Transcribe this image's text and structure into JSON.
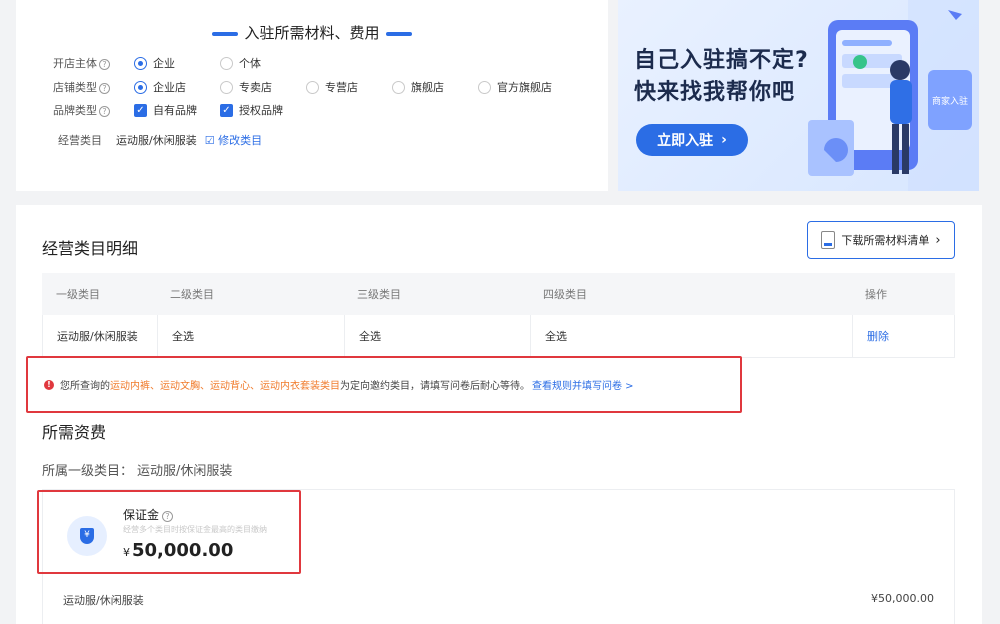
{
  "form": {
    "title": "入驻所需材料、费用",
    "rows": [
      {
        "label": "开店主体",
        "options": [
          "企业",
          "个体"
        ],
        "selected": 0
      },
      {
        "label": "店铺类型",
        "options": [
          "企业店",
          "专卖店",
          "专营店",
          "旗舰店",
          "官方旗舰店"
        ],
        "selected": 0
      },
      {
        "label": "品牌类型",
        "options": [
          "自有品牌",
          "授权品牌"
        ],
        "checked": [
          0,
          1
        ]
      }
    ],
    "category_label": "经营类目",
    "category_value": "运动服/休闲服装",
    "edit_link": "修改类目",
    "help_icon": "question-circle-icon"
  },
  "banner": {
    "line1": "自己入驻搞不定?",
    "line2": "快来找我帮你吧",
    "button": "立即入驻",
    "sign_text": "商家入驻"
  },
  "detail": {
    "title": "经营类目明细",
    "download_button": "下载所需材料清单",
    "columns": [
      "一级类目",
      "二级类目",
      "三级类目",
      "四级类目",
      "操作"
    ],
    "rows": [
      [
        "运动服/休闲服装",
        "全选",
        "全选",
        "全选",
        "删除"
      ]
    ]
  },
  "notice": {
    "prefix": "您所查询的",
    "highlight": "运动内裤、运动文胸、运动背心、运动内衣套装类目",
    "middle": "为定向邀约类目，请填写问卷后耐心等待。",
    "link": "查看规则并填写问卷 >"
  },
  "fees": {
    "title": "所需资费",
    "sub_label": "所属一级类目：",
    "sub_value": "运动服/休闲服装",
    "deposit_label": "保证金",
    "deposit_hint": "经营多个类目时按保证金最高的类目缴纳",
    "deposit_currency": "¥",
    "deposit_amount": "50,000.00",
    "row_name": "运动服/休闲服装",
    "row_amount": "¥50,000.00"
  },
  "colors": {
    "primary": "#2b6de5",
    "alert": "#e0383e",
    "highlight": "#f07a2a"
  }
}
